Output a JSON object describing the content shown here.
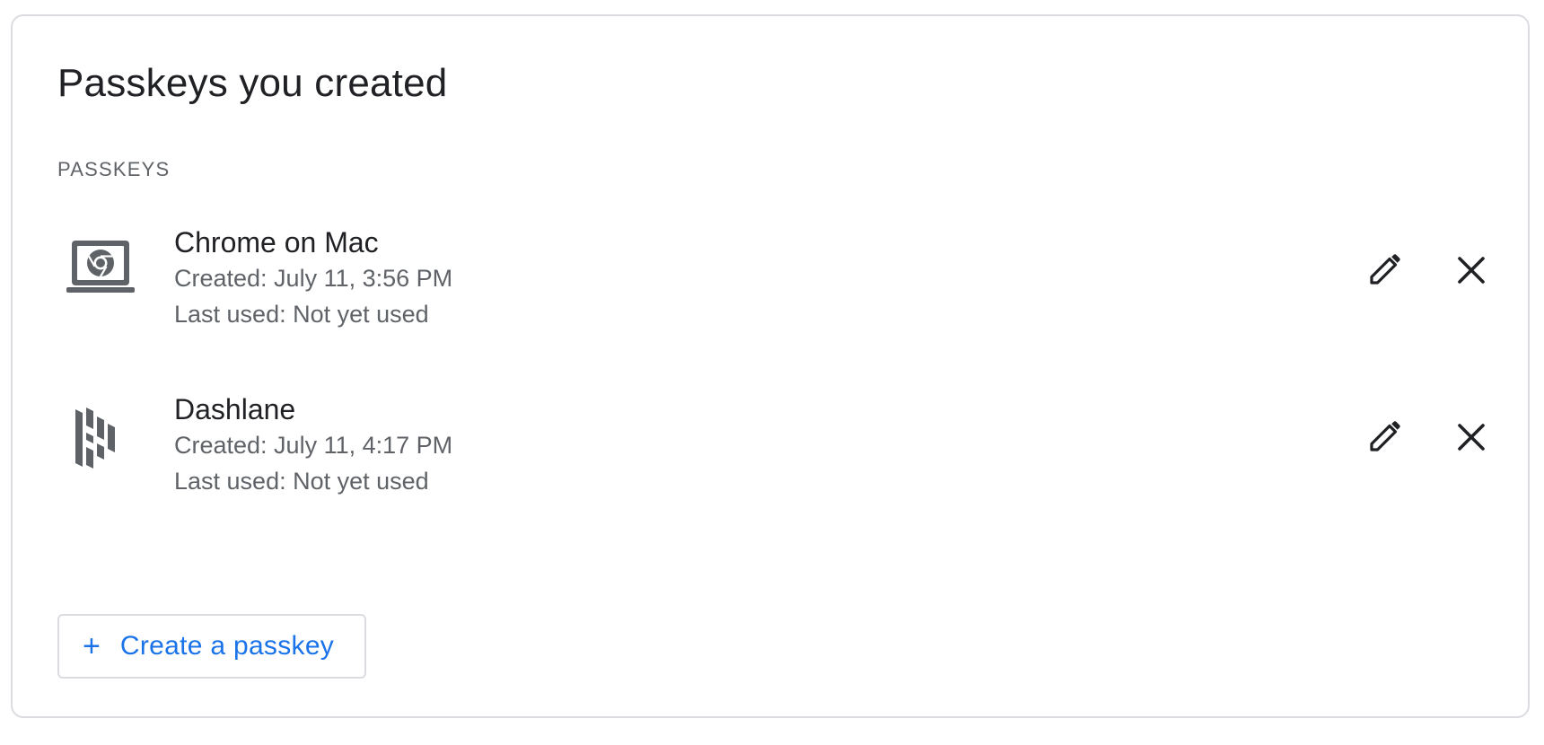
{
  "card": {
    "title": "Passkeys you created",
    "section_label": "PASSKEYS"
  },
  "passkeys": [
    {
      "name": "Chrome on Mac",
      "created": "Created: July 11, 3:56 PM",
      "last_used": "Last used: Not yet used",
      "icon": "laptop-chrome-icon"
    },
    {
      "name": "Dashlane",
      "created": "Created: July 11, 4:17 PM",
      "last_used": "Last used: Not yet used",
      "icon": "dashlane-icon"
    }
  ],
  "actions": {
    "edit_icon": "pencil-icon",
    "remove_icon": "close-icon"
  },
  "create_button": {
    "label": "Create a passkey",
    "plus": "+"
  },
  "colors": {
    "accent": "#1a73e8",
    "text_primary": "#202124",
    "text_secondary": "#5f6368",
    "border": "#dadce0",
    "icon_gray": "#5f6368"
  }
}
